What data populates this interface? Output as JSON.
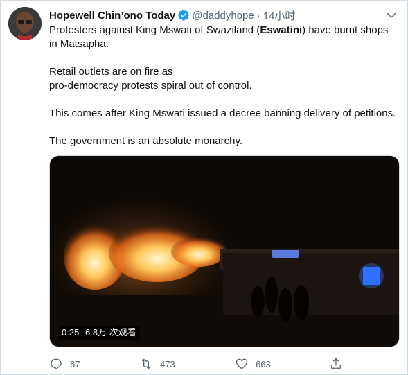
{
  "tweet": {
    "display_name": "Hopewell Chin’ono Today",
    "handle": "@daddyhope",
    "separator": "·",
    "time": "14小时",
    "text": {
      "line1_before": "Protesters against King Mswati of Swaziland (",
      "line1_bold": "Eswatini",
      "line1_after": ") have burnt shops in Matsapha.",
      "para2_line1": "Retail outlets are on fire as",
      "para2_line2": "pro-democracy protests spiral out of control.",
      "para3": "This comes after King Mswati issued a decree banning delivery of petitions.",
      "para4": "The government is an absolute monarchy."
    },
    "media": {
      "duration": "0:25",
      "views": "6.8万 次观看"
    },
    "actions": {
      "reply_count": "67",
      "retweet_count": "473",
      "like_count": "663"
    }
  },
  "icons": {
    "verified": "verified-badge-icon",
    "more": "chevron-down-icon",
    "reply": "reply-icon",
    "retweet": "retweet-icon",
    "like": "heart-icon",
    "share": "share-icon"
  },
  "colors": {
    "verified_blue": "#1d9bf0",
    "secondary_text": "#536471",
    "fire": "#ffb347"
  }
}
